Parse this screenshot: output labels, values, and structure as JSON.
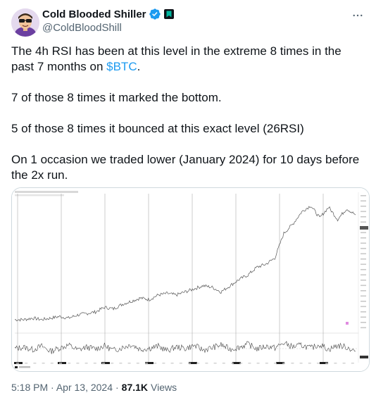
{
  "author": {
    "display_name": "Cold Blooded Shiller",
    "handle": "@ColdBloodShill",
    "verified_color": "#1d9bf0",
    "affiliate_badge_color": "#00b7a0",
    "icons": [
      "verified-badge-icon",
      "affiliate-badge-icon",
      "more-options-icon"
    ]
  },
  "tweet": {
    "line1_pre": "The 4h RSI has been at this level in the extreme 8 times in the past 7 months on ",
    "cashtag": "$BTC",
    "line1_post": ".",
    "para2": "7 of those 8 times it marked the bottom.",
    "para3": "5 of those 8 times it bounced at this exact level (26RSI)",
    "para4": "On 1 occasion we traded lower (January 2024) for 10 days before the 2x run."
  },
  "meta": {
    "time": "5:18 PM",
    "separator": "·",
    "date": "Apr 13, 2024",
    "separator2": "·",
    "views_count": "87.1K",
    "views_label": "Views"
  },
  "chart_data": {
    "type": "line",
    "title": "",
    "xlabel": "",
    "ylabel": "",
    "grid": false,
    "series": [
      {
        "values": [
          26,
          26,
          27,
          26,
          27,
          28,
          27,
          29,
          30,
          31,
          34,
          33,
          36,
          38,
          40,
          39,
          42,
          43,
          42,
          44,
          46,
          48,
          47,
          44,
          48,
          52,
          55,
          60,
          62,
          66,
          82,
          88,
          96,
          100,
          92,
          99,
          91,
          98,
          94
        ]
      },
      {
        "values": [
          48,
          52,
          45,
          55,
          40,
          50,
          58,
          44,
          52,
          47,
          56,
          43,
          51,
          60,
          46,
          49,
          55,
          42,
          53,
          48,
          57,
          44,
          50,
          59,
          46,
          52,
          61,
          47,
          55,
          50,
          64,
          53,
          58,
          49,
          60,
          45,
          57,
          52,
          40
        ]
      }
    ],
    "marked_occurrences": 8,
    "colors": {
      "price_line": "#555555",
      "rsi_line": "#444444",
      "marker_lines": "#999999",
      "highlight": "#e08be0"
    }
  }
}
